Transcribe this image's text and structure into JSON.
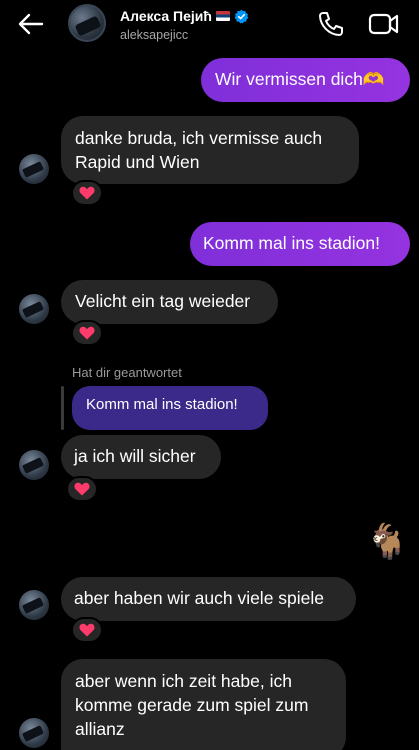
{
  "header": {
    "contact_name": "Алекса Пејић",
    "username": "aleksapejicc",
    "back_icon": "arrow-left-icon",
    "call_icon": "phone-icon",
    "video_icon": "video-camera-icon"
  },
  "messages": [
    {
      "dir": "out",
      "text": "Wir vermissen dich🫶"
    },
    {
      "dir": "in",
      "text": "danke bruda, ich vermisse auch Rapid und Wien",
      "reaction": "❤️"
    },
    {
      "dir": "out",
      "text": "Komm mal ins stadion!"
    },
    {
      "dir": "in",
      "text": "Velicht ein tag weieder",
      "reaction": "❤️"
    },
    {
      "dir": "in",
      "reply_label": "Hat dir geantwortet",
      "reply_to": "Komm mal ins stadion!",
      "text": "ja ich will sicher",
      "reaction": "❤️"
    },
    {
      "dir": "out",
      "text": "🐐"
    },
    {
      "dir": "in",
      "text": "aber haben wir auch viele spiele",
      "reaction": "❤️"
    },
    {
      "dir": "in",
      "text": "aber wenn ich zeit habe, ich komme gerade zum spiel zum allianz"
    }
  ],
  "colors": {
    "background": "#000000",
    "incoming_bubble": "#262626",
    "outgoing_bubble": "#8a2be2",
    "reply_bubble": "#3b2a8a",
    "verified_badge": "#0095f6",
    "reaction_heart": "#ff3b6b"
  }
}
